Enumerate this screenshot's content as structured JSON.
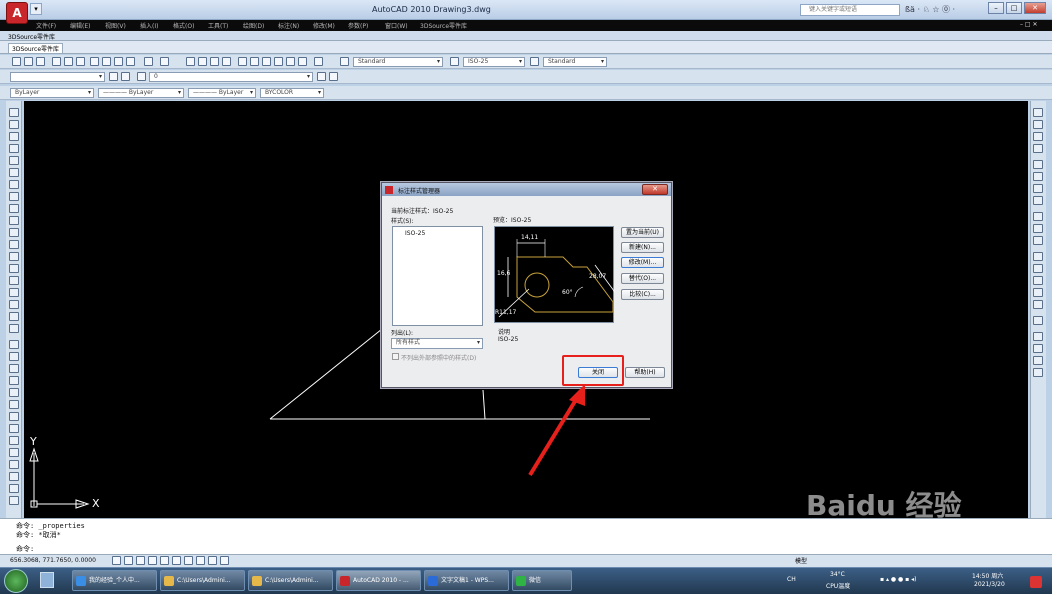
{
  "window": {
    "title": "AutoCAD 2010     Drawing3.dwg",
    "search_placeholder": "键入关键字或短语",
    "tray_icons_text": "ßä · ♘ ☆ ⓪ ·"
  },
  "menu": {
    "items": [
      "文件(F)",
      "编辑(E)",
      "视图(V)",
      "插入(I)",
      "格式(O)",
      "工具(T)",
      "绘图(D)",
      "标注(N)",
      "修改(M)",
      "参数(P)",
      "窗口(W)",
      "3DSource零件库"
    ]
  },
  "doc_tab": "3DSource零件库",
  "toolbar_tab": "3DSource零件库",
  "styles_toolbar": {
    "text_style": "Standard",
    "dim_style": "ISO-25",
    "table_style": "Standard",
    "layer_value": "0"
  },
  "properties_toolbar": {
    "color": "ByLayer",
    "linetype": "———— ByLayer",
    "lineweight": "———— ByLayer",
    "plotstyle": "BYCOLOR"
  },
  "ucs": {
    "y_label": "Y",
    "x_label": "X"
  },
  "dialog": {
    "title": "标注样式管理器",
    "close_glyph": "✕",
    "current_style_label": "当前标注样式：ISO-25",
    "styles_label": "样式(S):",
    "style_items": [
      "ISO-25"
    ],
    "preview_label": "预览：ISO-25",
    "list_label": "列出(L):",
    "list_value": "所有样式",
    "checkbox_label": "不列出外部参照中的样式(D)",
    "description_label": "说明",
    "description_value": "ISO-25",
    "buttons": {
      "set_current": "置为当前(U)",
      "new": "新建(N)...",
      "modify": "修改(M)...",
      "override": "替代(O)...",
      "compare": "比较(C)...",
      "close": "关闭",
      "help": "帮助(H)"
    },
    "preview_dims": {
      "top": "14,11",
      "left": "16,6",
      "right": "28,07",
      "angle": "60°",
      "radius": "R11,17"
    }
  },
  "command": {
    "lines": [
      "命令: _properties",
      "命令: *取消*",
      "命令:"
    ]
  },
  "status": {
    "coords": "656.3068,  771.7650,  0.0000",
    "model_label": "模型"
  },
  "taskbar": {
    "items": [
      {
        "label": "我的经验_个人中...",
        "color": "#3a8ee6"
      },
      {
        "label": "C:\\Users\\Admini...",
        "color": "#e6b84a"
      },
      {
        "label": "C:\\Users\\Admini...",
        "color": "#e6b84a"
      },
      {
        "label": "AutoCAD 2010 - ...",
        "color": "#c8262a"
      },
      {
        "label": "文字文稿1 - WPS...",
        "color": "#2a6bd8"
      },
      {
        "label": "微信",
        "color": "#2fb344"
      }
    ],
    "temp": "34°C",
    "temp_label": "CPU温度",
    "time": "14:50 周六",
    "date": "2021/3/20",
    "lang": "CH"
  },
  "watermark": "Baidu 经验"
}
